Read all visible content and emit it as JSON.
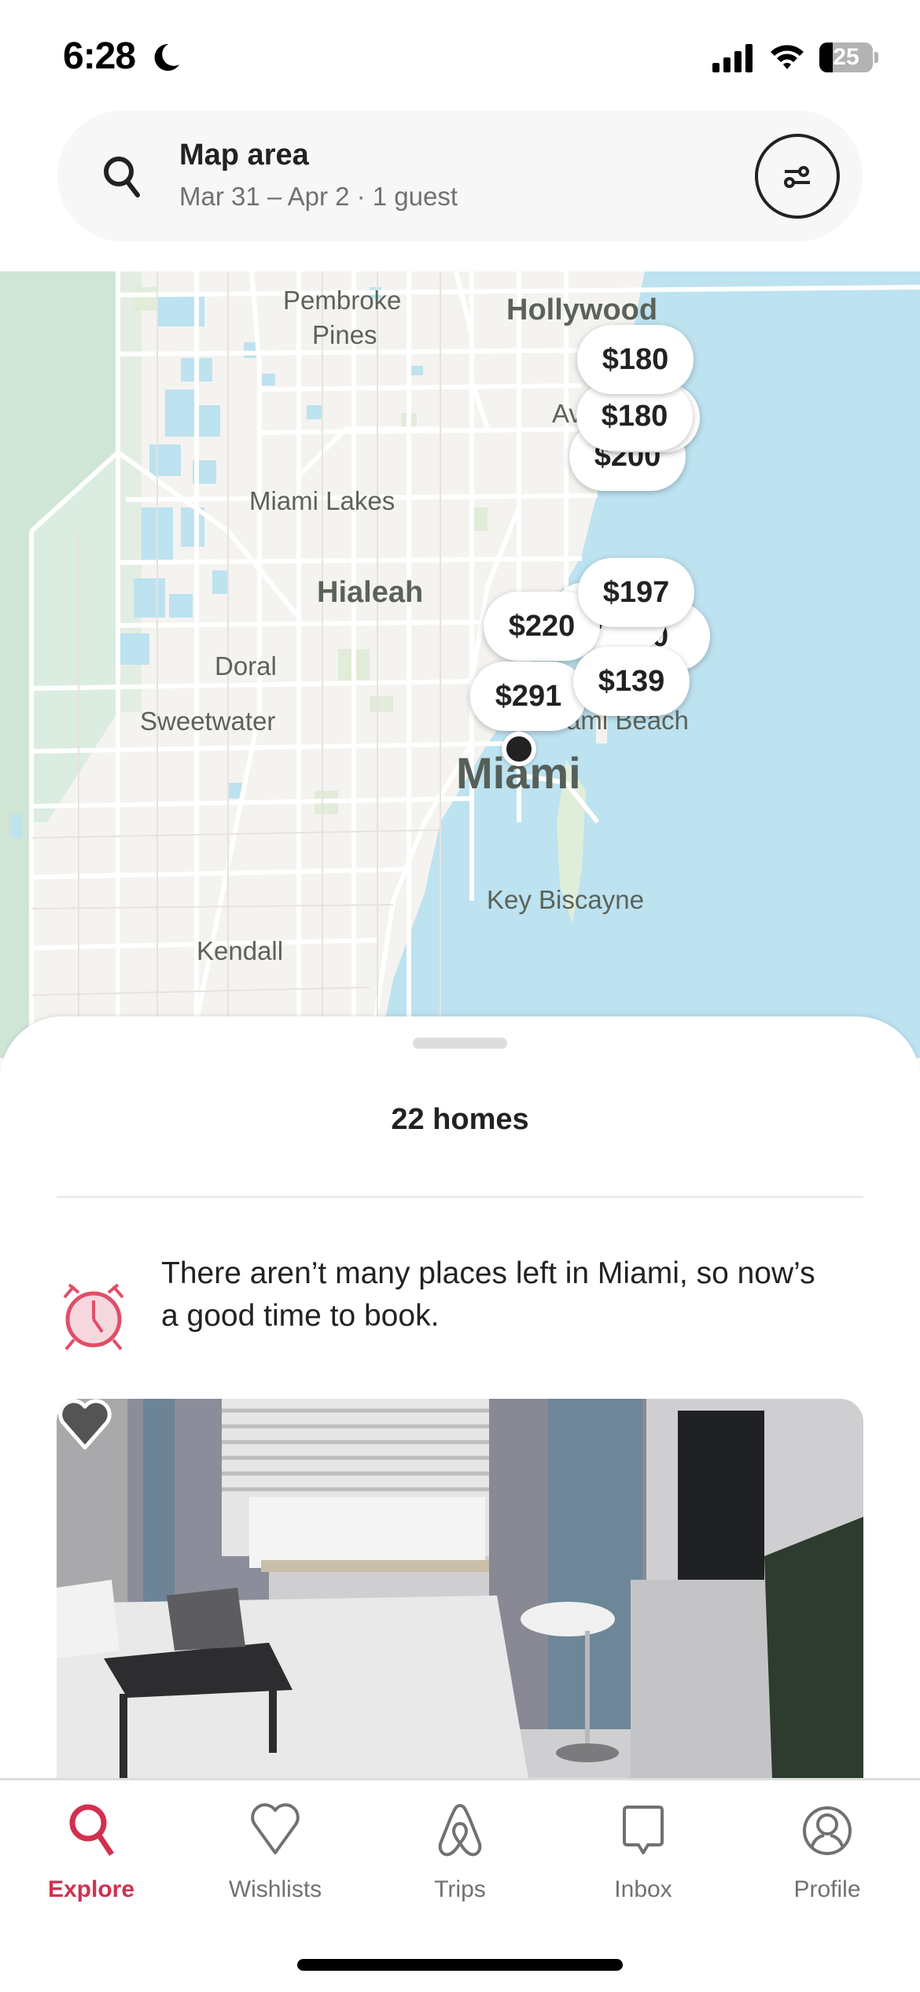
{
  "status_bar": {
    "time": "6:28",
    "focus_mode_icon": "moon-icon",
    "signal_icon": "cellular-signal-icon",
    "wifi_icon": "wifi-icon",
    "battery_percent": 25,
    "battery_label": "25"
  },
  "search": {
    "icon": "search-icon",
    "title": "Map area",
    "subtitle": "Mar 31 – Apr 2 · 1 guest",
    "filter_icon": "filter-sliders-icon",
    "filter_active": true
  },
  "map": {
    "labels": [
      {
        "text": "Pembroke",
        "kind": "town"
      },
      {
        "text": "Pines",
        "kind": "town"
      },
      {
        "text": "Hollywood",
        "kind": "town-large"
      },
      {
        "text": "Av",
        "kind": "town"
      },
      {
        "text": "Miami Lakes",
        "kind": "town"
      },
      {
        "text": "Hialeah",
        "kind": "town-large"
      },
      {
        "text": "Doral",
        "kind": "town"
      },
      {
        "text": "Sweetwater",
        "kind": "town"
      },
      {
        "text": "ami Beach",
        "kind": "town"
      },
      {
        "text": "Miami",
        "kind": "city"
      },
      {
        "text": "Key Biscayne",
        "kind": "town"
      },
      {
        "text": "Kendall",
        "kind": "town"
      }
    ],
    "price_pins": [
      {
        "label": "$200"
      },
      {
        "label": "$180"
      },
      {
        "label": "$180"
      },
      {
        "label": "$180"
      },
      {
        "label": "$220"
      },
      {
        "label": "$0"
      },
      {
        "label": "$197"
      },
      {
        "label": "$0"
      },
      {
        "label": "$291"
      },
      {
        "label": "$139"
      }
    ],
    "current_location_icon": "location-dot-icon",
    "colors": {
      "land": "#f5f3f0",
      "water": "#bde2f0",
      "park": "#dcebdd",
      "road": "#ffffff"
    }
  },
  "sheet": {
    "homes_count": "22 homes",
    "scarcity_icon": "alarm-clock-icon",
    "scarcity_message": "There aren’t many places left in Miami, so now’s a good time to book.",
    "listing": {
      "wishlist_icon": "heart-icon",
      "photo_description": "Bedroom with bed, laptop tray, window with blinds, TV stand and plant"
    }
  },
  "bottom_nav": {
    "accent_color": "#d1314f",
    "items": [
      {
        "label": "Explore",
        "icon": "search-icon",
        "active": true
      },
      {
        "label": "Wishlists",
        "icon": "heart-icon",
        "active": false
      },
      {
        "label": "Trips",
        "icon": "airbnb-logo-icon",
        "active": false
      },
      {
        "label": "Inbox",
        "icon": "message-bubble-icon",
        "active": false
      },
      {
        "label": "Profile",
        "icon": "profile-icon",
        "active": false
      }
    ]
  }
}
